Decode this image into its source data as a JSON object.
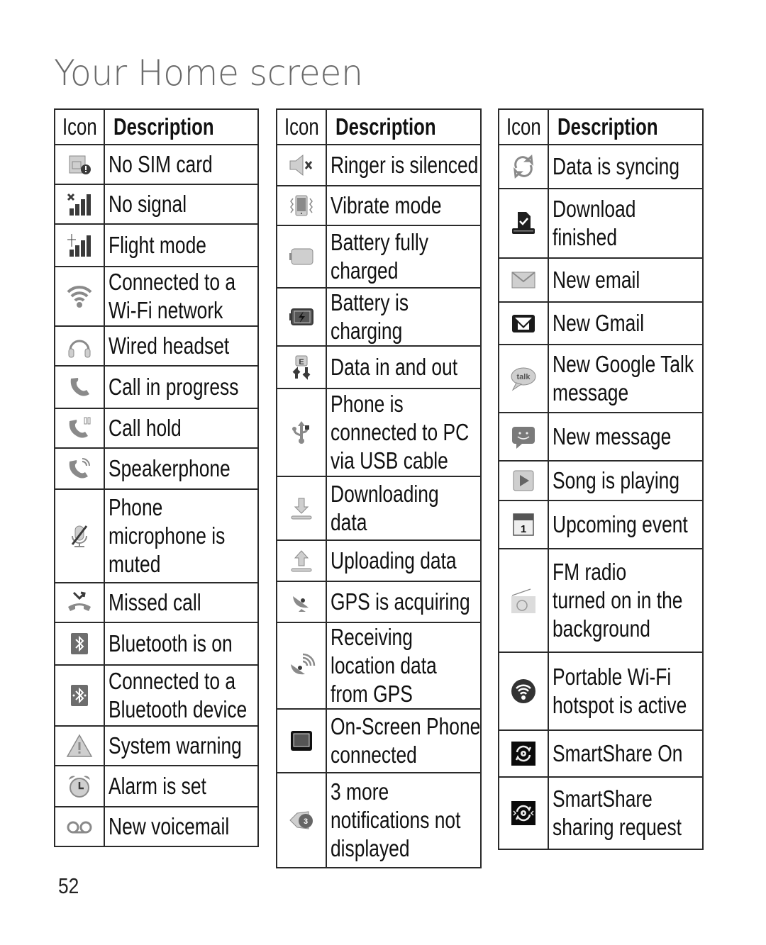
{
  "page": {
    "title": "Your Home screen",
    "page_number": "52"
  },
  "tables": [
    {
      "header": {
        "icon": "Icon",
        "description": "Description"
      },
      "rows": [
        {
          "icon": "no-sim-card-icon",
          "description": "No SIM card"
        },
        {
          "icon": "no-signal-icon",
          "description": "No signal"
        },
        {
          "icon": "flight-mode-icon",
          "description": "Flight mode"
        },
        {
          "icon": "wifi-connected-icon",
          "description": "Connected to a\nWi-Fi network"
        },
        {
          "icon": "wired-headset-icon",
          "description": "Wired headset"
        },
        {
          "icon": "call-in-progress-icon",
          "description": "Call in progress"
        },
        {
          "icon": "call-hold-icon",
          "description": "Call hold"
        },
        {
          "icon": "speakerphone-icon",
          "description": "Speakerphone"
        },
        {
          "icon": "microphone-muted-icon",
          "description": "Phone\nmicrophone is\nmuted"
        },
        {
          "icon": "missed-call-icon",
          "description": "Missed call"
        },
        {
          "icon": "bluetooth-on-icon",
          "description": "Bluetooth is on"
        },
        {
          "icon": "bluetooth-connected-icon",
          "description": "Connected to a\nBluetooth device"
        },
        {
          "icon": "system-warning-icon",
          "description": "System warning"
        },
        {
          "icon": "alarm-icon",
          "description": "Alarm is set"
        },
        {
          "icon": "voicemail-icon",
          "description": "New voicemail"
        }
      ]
    },
    {
      "header": {
        "icon": "Icon",
        "description": "Description"
      },
      "rows": [
        {
          "icon": "ringer-silenced-icon",
          "description": "Ringer is silenced"
        },
        {
          "icon": "vibrate-mode-icon",
          "description": "Vibrate mode"
        },
        {
          "icon": "battery-full-icon",
          "description": "Battery fully\ncharged"
        },
        {
          "icon": "battery-charging-icon",
          "description": "Battery is charging"
        },
        {
          "icon": "data-in-out-icon",
          "description": "Data in and out"
        },
        {
          "icon": "usb-connected-icon",
          "description": "Phone is\nconnected to PC\nvia USB cable"
        },
        {
          "icon": "downloading-icon",
          "description": "Downloading\ndata"
        },
        {
          "icon": "uploading-icon",
          "description": "Uploading data"
        },
        {
          "icon": "gps-acquiring-icon",
          "description": "GPS is acquiring"
        },
        {
          "icon": "gps-receiving-icon",
          "description": "Receiving\nlocation data\nfrom GPS"
        },
        {
          "icon": "on-screen-phone-icon",
          "description": "On-Screen Phone\nconnected"
        },
        {
          "icon": "more-notifications-icon",
          "description": "3 more\nnotifications not\ndisplayed",
          "badge": "3"
        }
      ]
    },
    {
      "header": {
        "icon": "Icon",
        "description": "Description"
      },
      "rows": [
        {
          "icon": "sync-icon",
          "description": "Data is syncing"
        },
        {
          "icon": "download-finished-icon",
          "description": "Download\nfinished"
        },
        {
          "icon": "email-icon",
          "description": "New email"
        },
        {
          "icon": "gmail-icon",
          "description": "New Gmail"
        },
        {
          "icon": "google-talk-icon",
          "description": "New Google Talk\nmessage",
          "badge": "talk"
        },
        {
          "icon": "new-message-icon",
          "description": "New message"
        },
        {
          "icon": "song-playing-icon",
          "description": "Song is playing"
        },
        {
          "icon": "calendar-event-icon",
          "description": "Upcoming event",
          "badge": "1"
        },
        {
          "icon": "fm-radio-icon",
          "description": "FM radio\nturned on in the\nbackground"
        },
        {
          "icon": "wifi-hotspot-icon",
          "description": "Portable Wi-Fi\nhotspot is active"
        },
        {
          "icon": "smartshare-on-icon",
          "description": "SmartShare On"
        },
        {
          "icon": "smartshare-request-icon",
          "description": "SmartShare\nsharing request"
        }
      ]
    }
  ]
}
